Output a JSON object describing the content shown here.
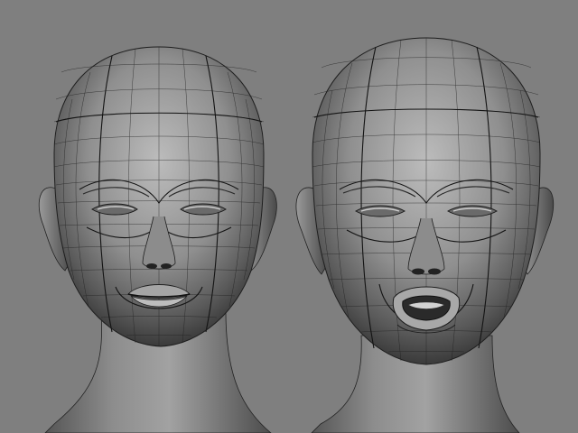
{
  "viewport": {
    "background": "#7f7f7f",
    "mesh_color": "#1e1e1e",
    "skin_light": "#bdbdbd",
    "skin_dark": "#3a3a3a"
  },
  "models": [
    {
      "expression": "neutral"
    },
    {
      "expression": "mouth-open"
    }
  ]
}
